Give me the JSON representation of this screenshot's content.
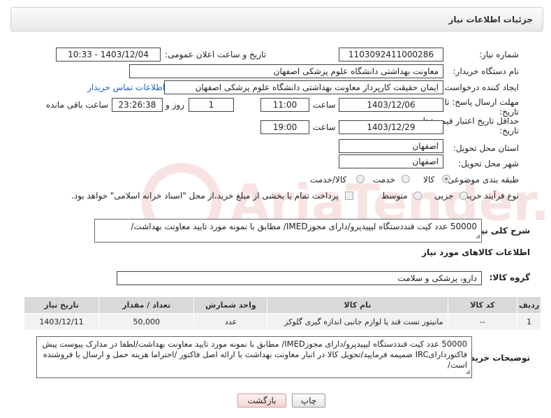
{
  "header": {
    "title": "جزئیات اطلاعات نیاز"
  },
  "fields": {
    "need_number_label": "شماره نیاز:",
    "need_number": "1103092411000286",
    "announce_label": "تاریخ و ساعت اعلان عمومی:",
    "announce_value": "1403/12/04 - 10:33",
    "buyer_label": "نام دستگاه خریدار:",
    "buyer_value": "معاونت بهداشتی دانشگاه علوم پزشکی اصفهان",
    "creator_label": "ایجاد کننده درخواست:",
    "creator_value": "ایمان حقیقت کارپرداز معاونت بهداشتی دانشگاه علوم پزشکی اصفهان",
    "contact_link": "اطلاعات تماس خریدار",
    "reply_deadline_label_1": "مهلت ارسال پاسخ: تا",
    "reply_deadline_label_2": "تاریخ:",
    "reply_date": "1403/12/06",
    "time_label": "ساعت",
    "reply_time": "11:00",
    "days_value": "1",
    "days_label": "روز و",
    "remaining_time": "23:26:38",
    "remaining_label": "ساعت باقی مانده",
    "price_validity_label_1": "حداقل تاریخ اعتبار قیمت: تا",
    "price_validity_label_2": "تاریخ:",
    "price_date": "1403/12/29",
    "price_time_label": "ساعت",
    "price_time": "19:00",
    "province_label": "استان محل تحویل:",
    "province_value": "اصفهان",
    "city_label": "شهر محل تحویل:",
    "city_value": "اصفهان",
    "category_label": "طبقه بندی موضوعی:",
    "category_options": [
      "کالا",
      "خدمت",
      "کالا/خدمت"
    ],
    "process_label": "نوع فرآیند خرید :",
    "process_options": [
      "جزیی",
      "متوسط"
    ],
    "payment_note": "پرداخت تمام یا بخشی از مبلغ خرید،از محل \"اسناد خزانه اسلامی\" خواهد بود."
  },
  "description": {
    "label": "شرح کلی نیاز:",
    "text": "50000 عدد  کیت قنددستگاه لیپیدپرو/دارای مجوزIMED/ مطابق با نمونه مورد تایید معاونت بهداشت/"
  },
  "goods": {
    "section_title": "اطلاعات کالاهای مورد نیاز",
    "group_label": "گروه کالا:",
    "group_value": "دارو، پزشکی و سلامت",
    "columns": [
      "ردیف",
      "کد کالا",
      "نام کالا",
      "واحد شمارش",
      "تعداد / مقدار",
      "تاریخ نیاز"
    ],
    "rows": [
      [
        "1",
        "--",
        "مانیتور تست قند یا لوازم جانبی اندازه گیری گلوکز",
        "عدد",
        "50,000",
        "1403/12/11"
      ]
    ]
  },
  "buyer_notes": {
    "label": "توضیحات خریدار:",
    "text": "50000 عدد  کیت قنددستگاه لیپیدپرو/دارای مجوزIMED/ مطابق با نمونه مورد تایید معاونت بهداشت/لطفا در مدارک پیوست پیش فاکتوردارایIRC ضمیمه فرمایید/تحویل کالا در انبار معاونت بهداشت با ارائه اصل فاکتور /احتراما هزینه حمل و ارسال با فروشنده است/"
  },
  "buttons": {
    "print": "چاپ",
    "back": "بازگشت"
  },
  "watermark": {
    "text": "AriaTender.net"
  }
}
